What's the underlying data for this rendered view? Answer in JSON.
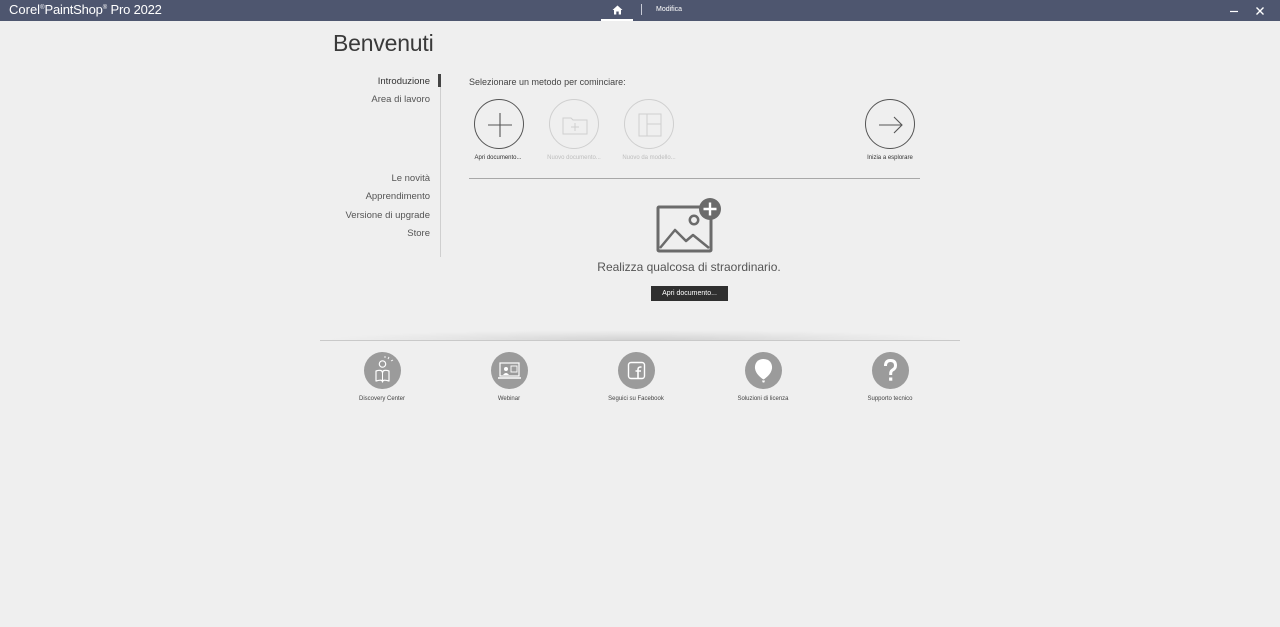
{
  "app": {
    "brand_prefix": "Corel",
    "brand_reg": "®",
    "brand_name": "PaintShop",
    "brand_reg2": "®",
    "brand_suffix": " Pro 2022"
  },
  "tabs": {
    "home_icon": "home-icon",
    "edit_label": "Modifica"
  },
  "window": {
    "minimize_glyph": "–",
    "close_glyph": "✕"
  },
  "page": {
    "title": "Benvenuti"
  },
  "nav": {
    "items": [
      {
        "label": "Introduzione",
        "active": true
      },
      {
        "label": "Area di lavoro"
      },
      {
        "label": "Le novità"
      },
      {
        "label": "Apprendimento"
      },
      {
        "label": "Versione di upgrade"
      },
      {
        "label": "Store"
      }
    ]
  },
  "methods": {
    "title": "Selezionare un metodo per cominciare:",
    "items": [
      {
        "label": "Apri documento...",
        "icon": "plus-icon",
        "enabled": true
      },
      {
        "label": "Nuovo documento...",
        "icon": "new-document-icon",
        "enabled": false
      },
      {
        "label": "Nuovo da modello...",
        "icon": "template-icon",
        "enabled": false
      },
      {
        "label": "Inizia a esplorare",
        "icon": "arrow-right-icon",
        "enabled": true
      }
    ]
  },
  "hero": {
    "icon": "image-add-icon",
    "tagline": "Realizza qualcosa di straordinario.",
    "button_label": "Apri documento..."
  },
  "footer": {
    "items": [
      {
        "label": "Discovery Center",
        "icon": "discovery-center-icon"
      },
      {
        "label": "Webinar",
        "icon": "webinar-icon"
      },
      {
        "label": "Seguici su Facebook",
        "icon": "facebook-icon"
      },
      {
        "label": "Soluzioni di licenza",
        "icon": "balloon-icon"
      },
      {
        "label": "Supporto tecnico",
        "icon": "question-icon"
      }
    ]
  },
  "colors": {
    "titlebar": "#4e566f",
    "background": "#efefef",
    "button_dark": "#2f2f2f",
    "footer_icon": "#9b9b9b"
  }
}
